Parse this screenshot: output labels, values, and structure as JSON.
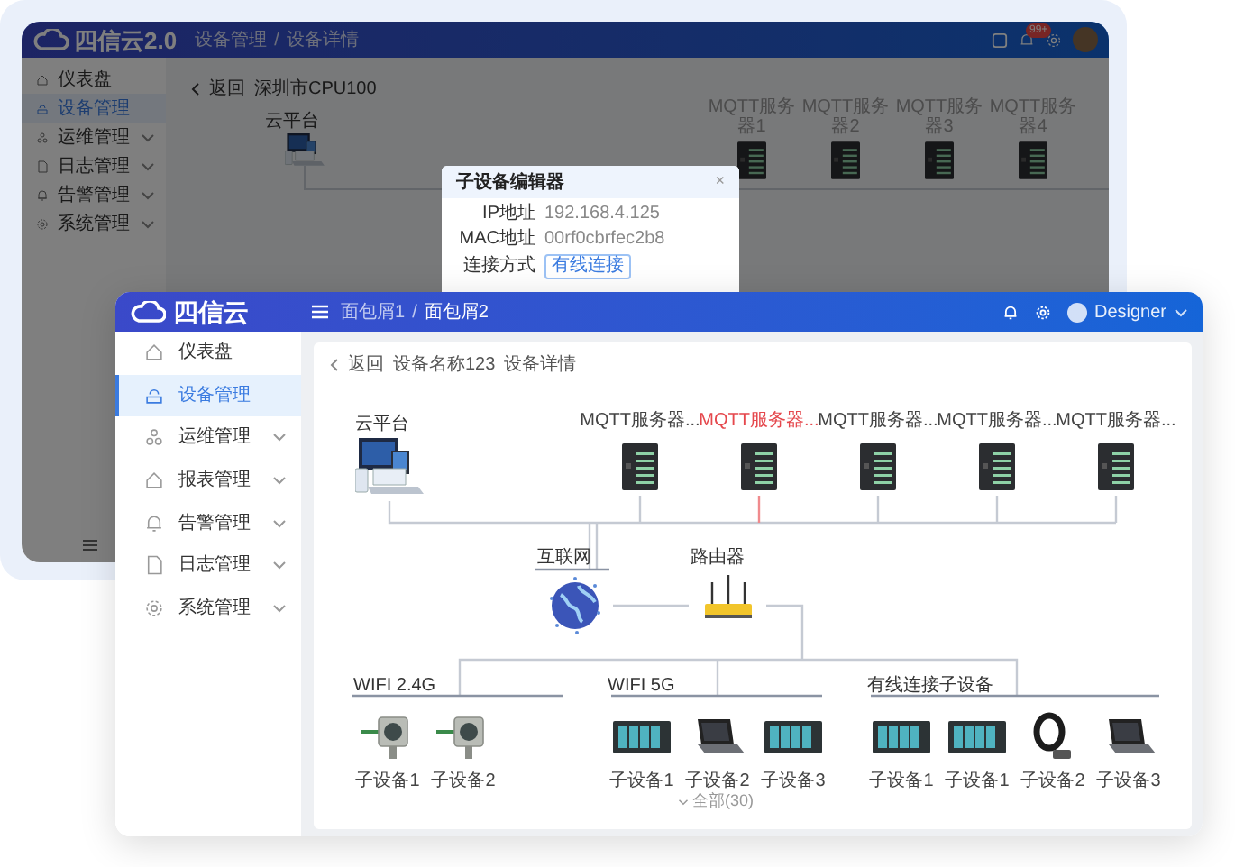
{
  "background_window": {
    "app_name": "四信云2.0",
    "breadcrumb": [
      "设备管理",
      "设备详情"
    ],
    "breadcrumb_separator": "/",
    "notification_badge": "99+",
    "sidebar": [
      {
        "label": "仪表盘",
        "selected": false,
        "expandable": false
      },
      {
        "label": "设备管理",
        "selected": true,
        "expandable": false
      },
      {
        "label": "运维管理",
        "selected": false,
        "expandable": true
      },
      {
        "label": "日志管理",
        "selected": false,
        "expandable": true
      },
      {
        "label": "告警管理",
        "selected": false,
        "expandable": true
      },
      {
        "label": "系统管理",
        "selected": false,
        "expandable": true
      }
    ],
    "back": "返回",
    "device_name": "深圳市CPU100",
    "cloud_label": "云平台",
    "servers": [
      "MQTT服务器1",
      "MQTT服务器2",
      "MQTT服务器3",
      "MQTT服务器4"
    ],
    "dialog": {
      "title": "子设备编辑器",
      "close": "×",
      "fields": [
        {
          "label": "IP地址",
          "value": "192.168.4.125"
        },
        {
          "label": "MAC地址",
          "value": "00rf0cbrfec2b8"
        },
        {
          "label": "连接方式",
          "tag": "有线连接"
        }
      ]
    }
  },
  "window": {
    "app_name": "四信云",
    "breadcrumb": [
      "面包屑1",
      "面包屑2"
    ],
    "breadcrumb_separator": "/",
    "user": "Designer",
    "sidebar": [
      {
        "label": "仪表盘",
        "selected": false,
        "expandable": false
      },
      {
        "label": "设备管理",
        "selected": true,
        "expandable": false
      },
      {
        "label": "运维管理",
        "selected": false,
        "expandable": true
      },
      {
        "label": "报表管理",
        "selected": false,
        "expandable": true
      },
      {
        "label": "告警管理",
        "selected": false,
        "expandable": true
      },
      {
        "label": "日志管理",
        "selected": false,
        "expandable": true
      },
      {
        "label": "系统管理",
        "selected": false,
        "expandable": true
      }
    ],
    "back": "返回",
    "device_name": "设备名称123",
    "page_title": "设备详情",
    "cloud_label": "云平台",
    "servers": [
      {
        "label": "MQTT服务器...",
        "alert": false
      },
      {
        "label": "MQTT服务器...",
        "alert": true
      },
      {
        "label": "MQTT服务器...",
        "alert": false
      },
      {
        "label": "MQTT服务器...",
        "alert": false
      },
      {
        "label": "MQTT服务器...",
        "alert": false
      }
    ],
    "internet_label": "互联网",
    "router_label": "路由器",
    "groups": [
      {
        "label": "WIFI 2.4G",
        "devices": [
          {
            "kind": "sensor",
            "label": "子设备1"
          },
          {
            "kind": "sensor",
            "label": "子设备2"
          }
        ]
      },
      {
        "label": "WIFI 5G",
        "devices": [
          {
            "kind": "plc",
            "label": "子设备1"
          },
          {
            "kind": "laptop",
            "label": "子设备2"
          },
          {
            "kind": "plc",
            "label": "子设备3"
          }
        ]
      },
      {
        "label": "有线连接子设备",
        "devices": [
          {
            "kind": "plc",
            "label": "子设备1"
          },
          {
            "kind": "plc",
            "label": "子设备1"
          },
          {
            "kind": "coil",
            "label": "子设备2"
          },
          {
            "kind": "laptop",
            "label": "子设备3"
          }
        ]
      }
    ],
    "more": "全部(30)"
  }
}
